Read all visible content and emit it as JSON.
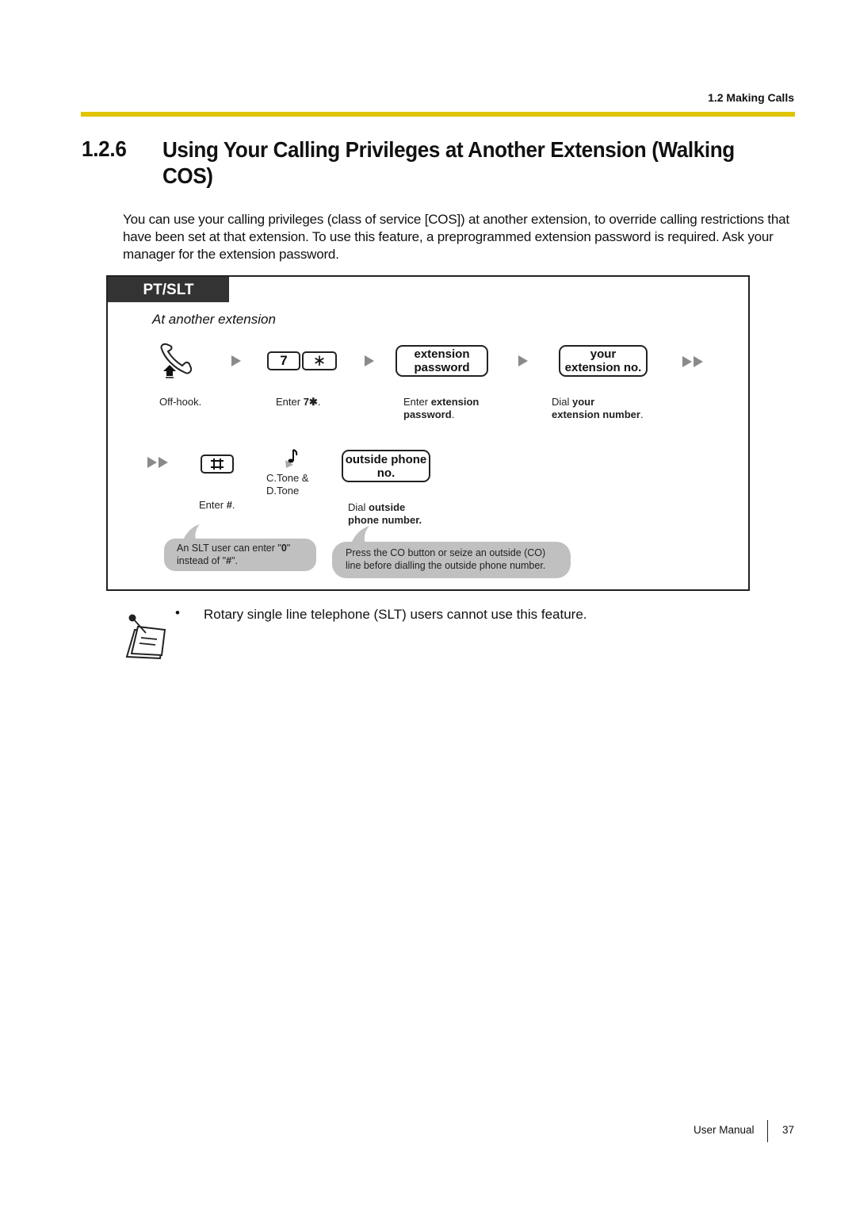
{
  "header": {
    "section": "1.2 Making Calls",
    "rule_color": "#e0c400"
  },
  "title": {
    "number": "1.2.6",
    "text": "Using Your Calling Privileges at Another Extension (Walking COS)"
  },
  "intro": "You can use your calling privileges (class of service [COS]) at another extension, to override calling restrictions that have been set at that extension. To use this feature, a preprogrammed extension password is required. Ask your manager for the extension password.",
  "panel": {
    "tab_label": "PT/SLT",
    "subheading": "At another extension",
    "steps": [
      {
        "icon": "off-hook-icon",
        "caption": "Off-hook."
      },
      {
        "keys": [
          "7",
          "∗"
        ],
        "caption_prefix": "Enter ",
        "caption_bold": "7✱",
        "caption_suffix": "."
      },
      {
        "pill_lines": [
          "extension",
          "password"
        ],
        "caption_prefix": "Enter ",
        "caption_bold_1": "extension",
        "caption_bold_2": "password",
        "caption_suffix": "."
      },
      {
        "pill_lines": [
          "your",
          "extension no."
        ],
        "caption_prefix": "Dial ",
        "caption_bold_1": "your",
        "caption_bold_2": "extension number",
        "caption_suffix": "."
      },
      {
        "key": "#",
        "caption_prefix": "Enter ",
        "caption_bold": "#",
        "caption_suffix": "."
      },
      {
        "icon": "tone-icon",
        "caption_line1": "C.Tone &",
        "caption_line2": "D.Tone"
      },
      {
        "pill_lines": [
          "outside phone",
          "no."
        ],
        "caption_prefix": "Dial ",
        "caption_bold_1": "outside",
        "caption_bold_2": "phone number."
      }
    ],
    "bubbles": [
      {
        "line1_prefix": "An SLT user can enter \"",
        "line1_bold": "0",
        "line1_suffix": "\"",
        "line2_prefix": "instead of \"",
        "line2_bold": "#",
        "line2_suffix": "\"."
      },
      {
        "line1": "Press the CO button or seize an outside (CO)",
        "line2": "line before dialling the outside phone number."
      }
    ]
  },
  "note": {
    "bullet": "•",
    "text": "Rotary single line telephone (SLT) users cannot use this feature."
  },
  "footer": {
    "label": "User Manual",
    "page": "37"
  }
}
